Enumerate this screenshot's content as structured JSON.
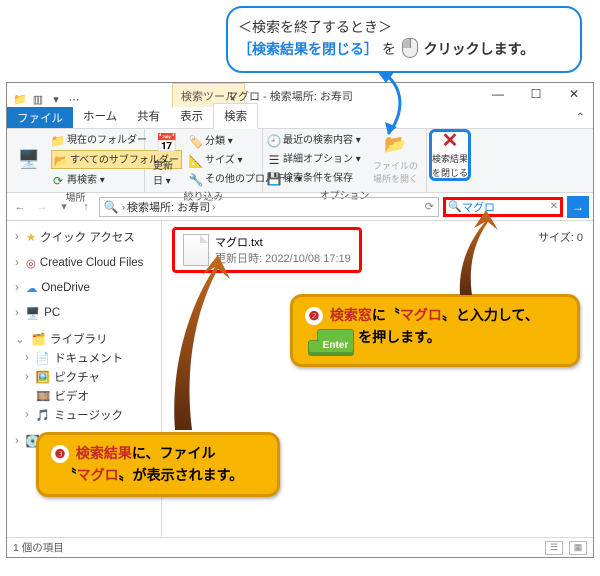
{
  "callout_top": {
    "line1": "＜検索を終了するとき＞",
    "link": "［検索結果を閉じる］",
    "suffix1": "を",
    "suffix2": "クリックします。"
  },
  "title": {
    "context_tab": "検索ツール",
    "window_title": "マグロ - 検索場所: お寿司"
  },
  "tabs": {
    "file": "ファイル",
    "home": "ホーム",
    "share": "共有",
    "view": "表示",
    "search": "検索"
  },
  "ribbon": {
    "group1": {
      "current_folder": "現在のフォルダー",
      "all_subfolders": "すべてのサブフォルダー",
      "search_again": "再検索 ▾",
      "label": "場所"
    },
    "group2": {
      "date": "更新日 ▾",
      "kind": "分類 ▾",
      "size": "サイズ ▾",
      "other": "その他のプロパティ ▾",
      "label": "絞り込み"
    },
    "group3": {
      "recent": "最近の検索内容 ▾",
      "adv": "詳細オプション ▾",
      "save": "検索条件を保存",
      "open_loc": "ファイルの\n場所を開く",
      "label": "オプション"
    },
    "close": {
      "line1": "検索結果",
      "line2": "を閉じる"
    }
  },
  "address": {
    "crumb1": "検索場所: お寿司",
    "sep": "›"
  },
  "search": {
    "value": "マグロ"
  },
  "tree": {
    "quick": "クイック アクセス",
    "ccf": "Creative Cloud Files",
    "onedrive": "OneDrive",
    "pc": "PC",
    "lib": "ライブラリ",
    "docs": "ドキュメント",
    "pics": "ピクチャ",
    "vids": "ビデオ",
    "music": "ミュージック"
  },
  "content": {
    "size_label": "サイズ: 0",
    "file_name": "マグロ.txt",
    "file_meta": "更新日時: 2022/10/08 17:19"
  },
  "callout2": {
    "num": "❷",
    "a": "検索窓",
    "b": "に〝",
    "c": "マグロ",
    "d": "〟と入力して、",
    "e": "を押します。",
    "enter": "Enter"
  },
  "callout3": {
    "num": "❸",
    "a": "検索結果",
    "b": "に、ファイル",
    "c": "〝",
    "d": "マグロ",
    "e": "〟が表示されます。"
  },
  "status": {
    "count": "1 個の項目"
  }
}
